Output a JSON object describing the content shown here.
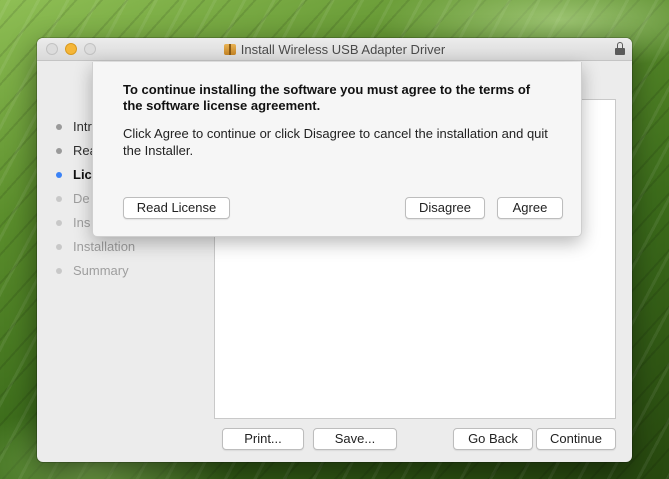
{
  "window": {
    "title": "Install Wireless USB Adapter Driver",
    "icons": {
      "title": "package-icon",
      "lock": "lock-icon"
    },
    "traffic_light_colors": {
      "close": "#dcdcdc",
      "minimize": "#f5b638",
      "zoom": "#dcdcdc"
    }
  },
  "sidebar": {
    "steps": [
      {
        "label": "Intr",
        "state": "done"
      },
      {
        "label": "Rea",
        "state": "done"
      },
      {
        "label": "Lic",
        "state": "current"
      },
      {
        "label": "De",
        "state": "future"
      },
      {
        "label": "Ins",
        "state": "future"
      },
      {
        "label": "Installation",
        "state": "future"
      },
      {
        "label": "Summary",
        "state": "future"
      }
    ],
    "current_dot_color": "#3b82f6"
  },
  "buttons": {
    "print": "Print...",
    "save": "Save...",
    "go_back": "Go Back",
    "continue": "Continue"
  },
  "sheet": {
    "heading": "To continue installing the software you must agree to the terms of the software license agreement.",
    "message": "Click Agree to continue or click Disagree to cancel the installation and quit the Installer.",
    "read_license": "Read License",
    "disagree": "Disagree",
    "agree": "Agree"
  }
}
